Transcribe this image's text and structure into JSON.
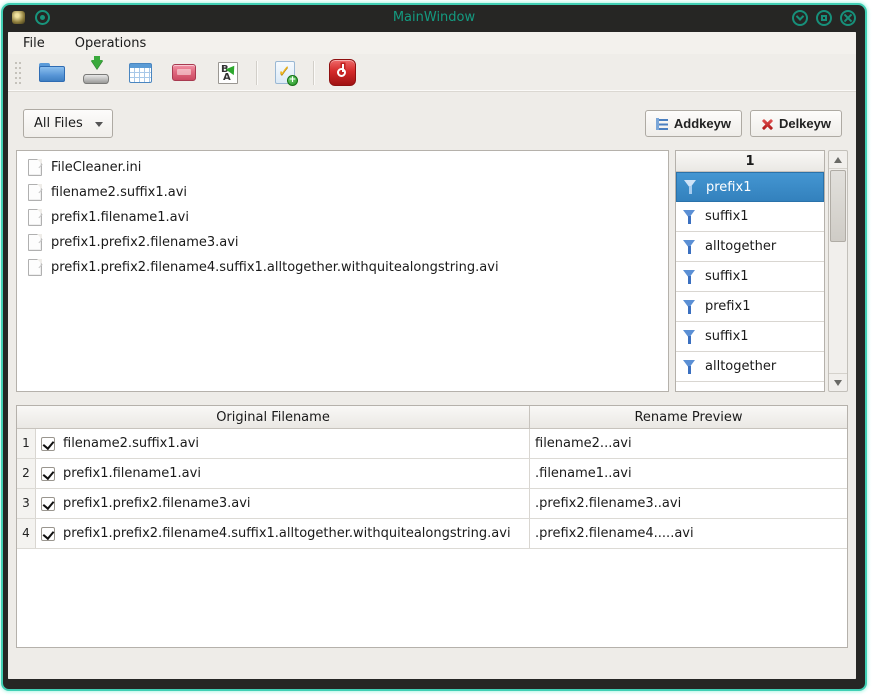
{
  "theme": {
    "accent_teal": "#41cfb4",
    "titlebar_bg": "#262624",
    "title_text": "#149a80",
    "selection_blue": "#3a8dcc",
    "window_bg": "#eeece8",
    "exit_red": "#d42a2a"
  },
  "window": {
    "title": "MainWindow",
    "titlebar_icons": [
      "app-icon",
      "pin-icon",
      "minimize-icon",
      "maximize-icon",
      "close-icon"
    ]
  },
  "menu": {
    "items": [
      "File",
      "Operations"
    ]
  },
  "toolbar": {
    "icons": [
      "open-folder-icon",
      "save-drive-icon",
      "table-view-icon",
      "clean-box-icon",
      "rename-letters-icon",
      "select-add-icon",
      "exit-power-icon"
    ]
  },
  "filter_combo": {
    "selected": "All Files",
    "icon": "chevron-down-icon"
  },
  "keyword_buttons": {
    "add_label": "Addkeyw",
    "add_icon": "list-icon",
    "del_label": "Delkeyw",
    "del_icon": "red-x-icon"
  },
  "file_list": [
    "FileCleaner.ini",
    "filename2.suffix1.avi",
    "prefix1.filename1.avi",
    "prefix1.prefix2.filename3.avi",
    "prefix1.prefix2.filename4.suffix1.alltogether.withquitealongstring.avi"
  ],
  "keywords": {
    "header": "1",
    "icon": "funnel-icon",
    "selected_index": 0,
    "items": [
      "prefix1",
      "suffix1",
      "alltogether",
      "suffix1",
      "prefix1",
      "suffix1",
      "alltogether"
    ]
  },
  "preview_table": {
    "columns": [
      "Original Filename",
      "Rename Preview"
    ],
    "rows": [
      {
        "num": "1",
        "checked": true,
        "original": "filename2.suffix1.avi",
        "preview": "filename2...avi"
      },
      {
        "num": "2",
        "checked": true,
        "original": "prefix1.filename1.avi",
        "preview": ".filename1..avi"
      },
      {
        "num": "3",
        "checked": true,
        "original": "prefix1.prefix2.filename3.avi",
        "preview": ".prefix2.filename3..avi"
      },
      {
        "num": "4",
        "checked": true,
        "original": "prefix1.prefix2.filename4.suffix1.alltogether.withquitealongstring.avi",
        "preview": ".prefix2.filename4.....avi"
      }
    ]
  }
}
